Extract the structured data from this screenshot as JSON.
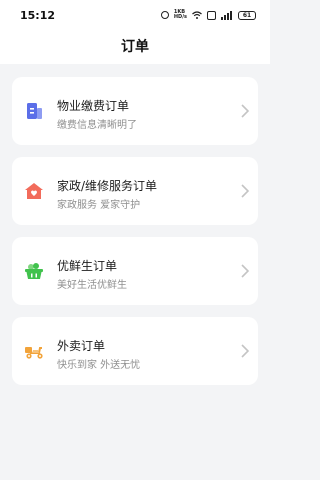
{
  "status_bar": {
    "time": "15:12",
    "battery": "61",
    "hd_top": "1KB",
    "hd_bottom": "HD/s"
  },
  "page": {
    "title": "订单"
  },
  "orders": [
    {
      "title": "物业缴费订单",
      "subtitle": "缴费信息清晰明了",
      "icon": "building-icon",
      "color": "#5b6ee8"
    },
    {
      "title": "家政/维修服务订单",
      "subtitle": "家政服务 爱家守护",
      "icon": "house-heart-icon",
      "color": "#f26b5b"
    },
    {
      "title": "优鲜生订单",
      "subtitle": "美好生活优鲜生",
      "icon": "basket-icon",
      "color": "#41c24d"
    },
    {
      "title": "外卖订单",
      "subtitle": "快乐到家 外送无忧",
      "icon": "scooter-icon",
      "color": "#f2a33a"
    }
  ]
}
